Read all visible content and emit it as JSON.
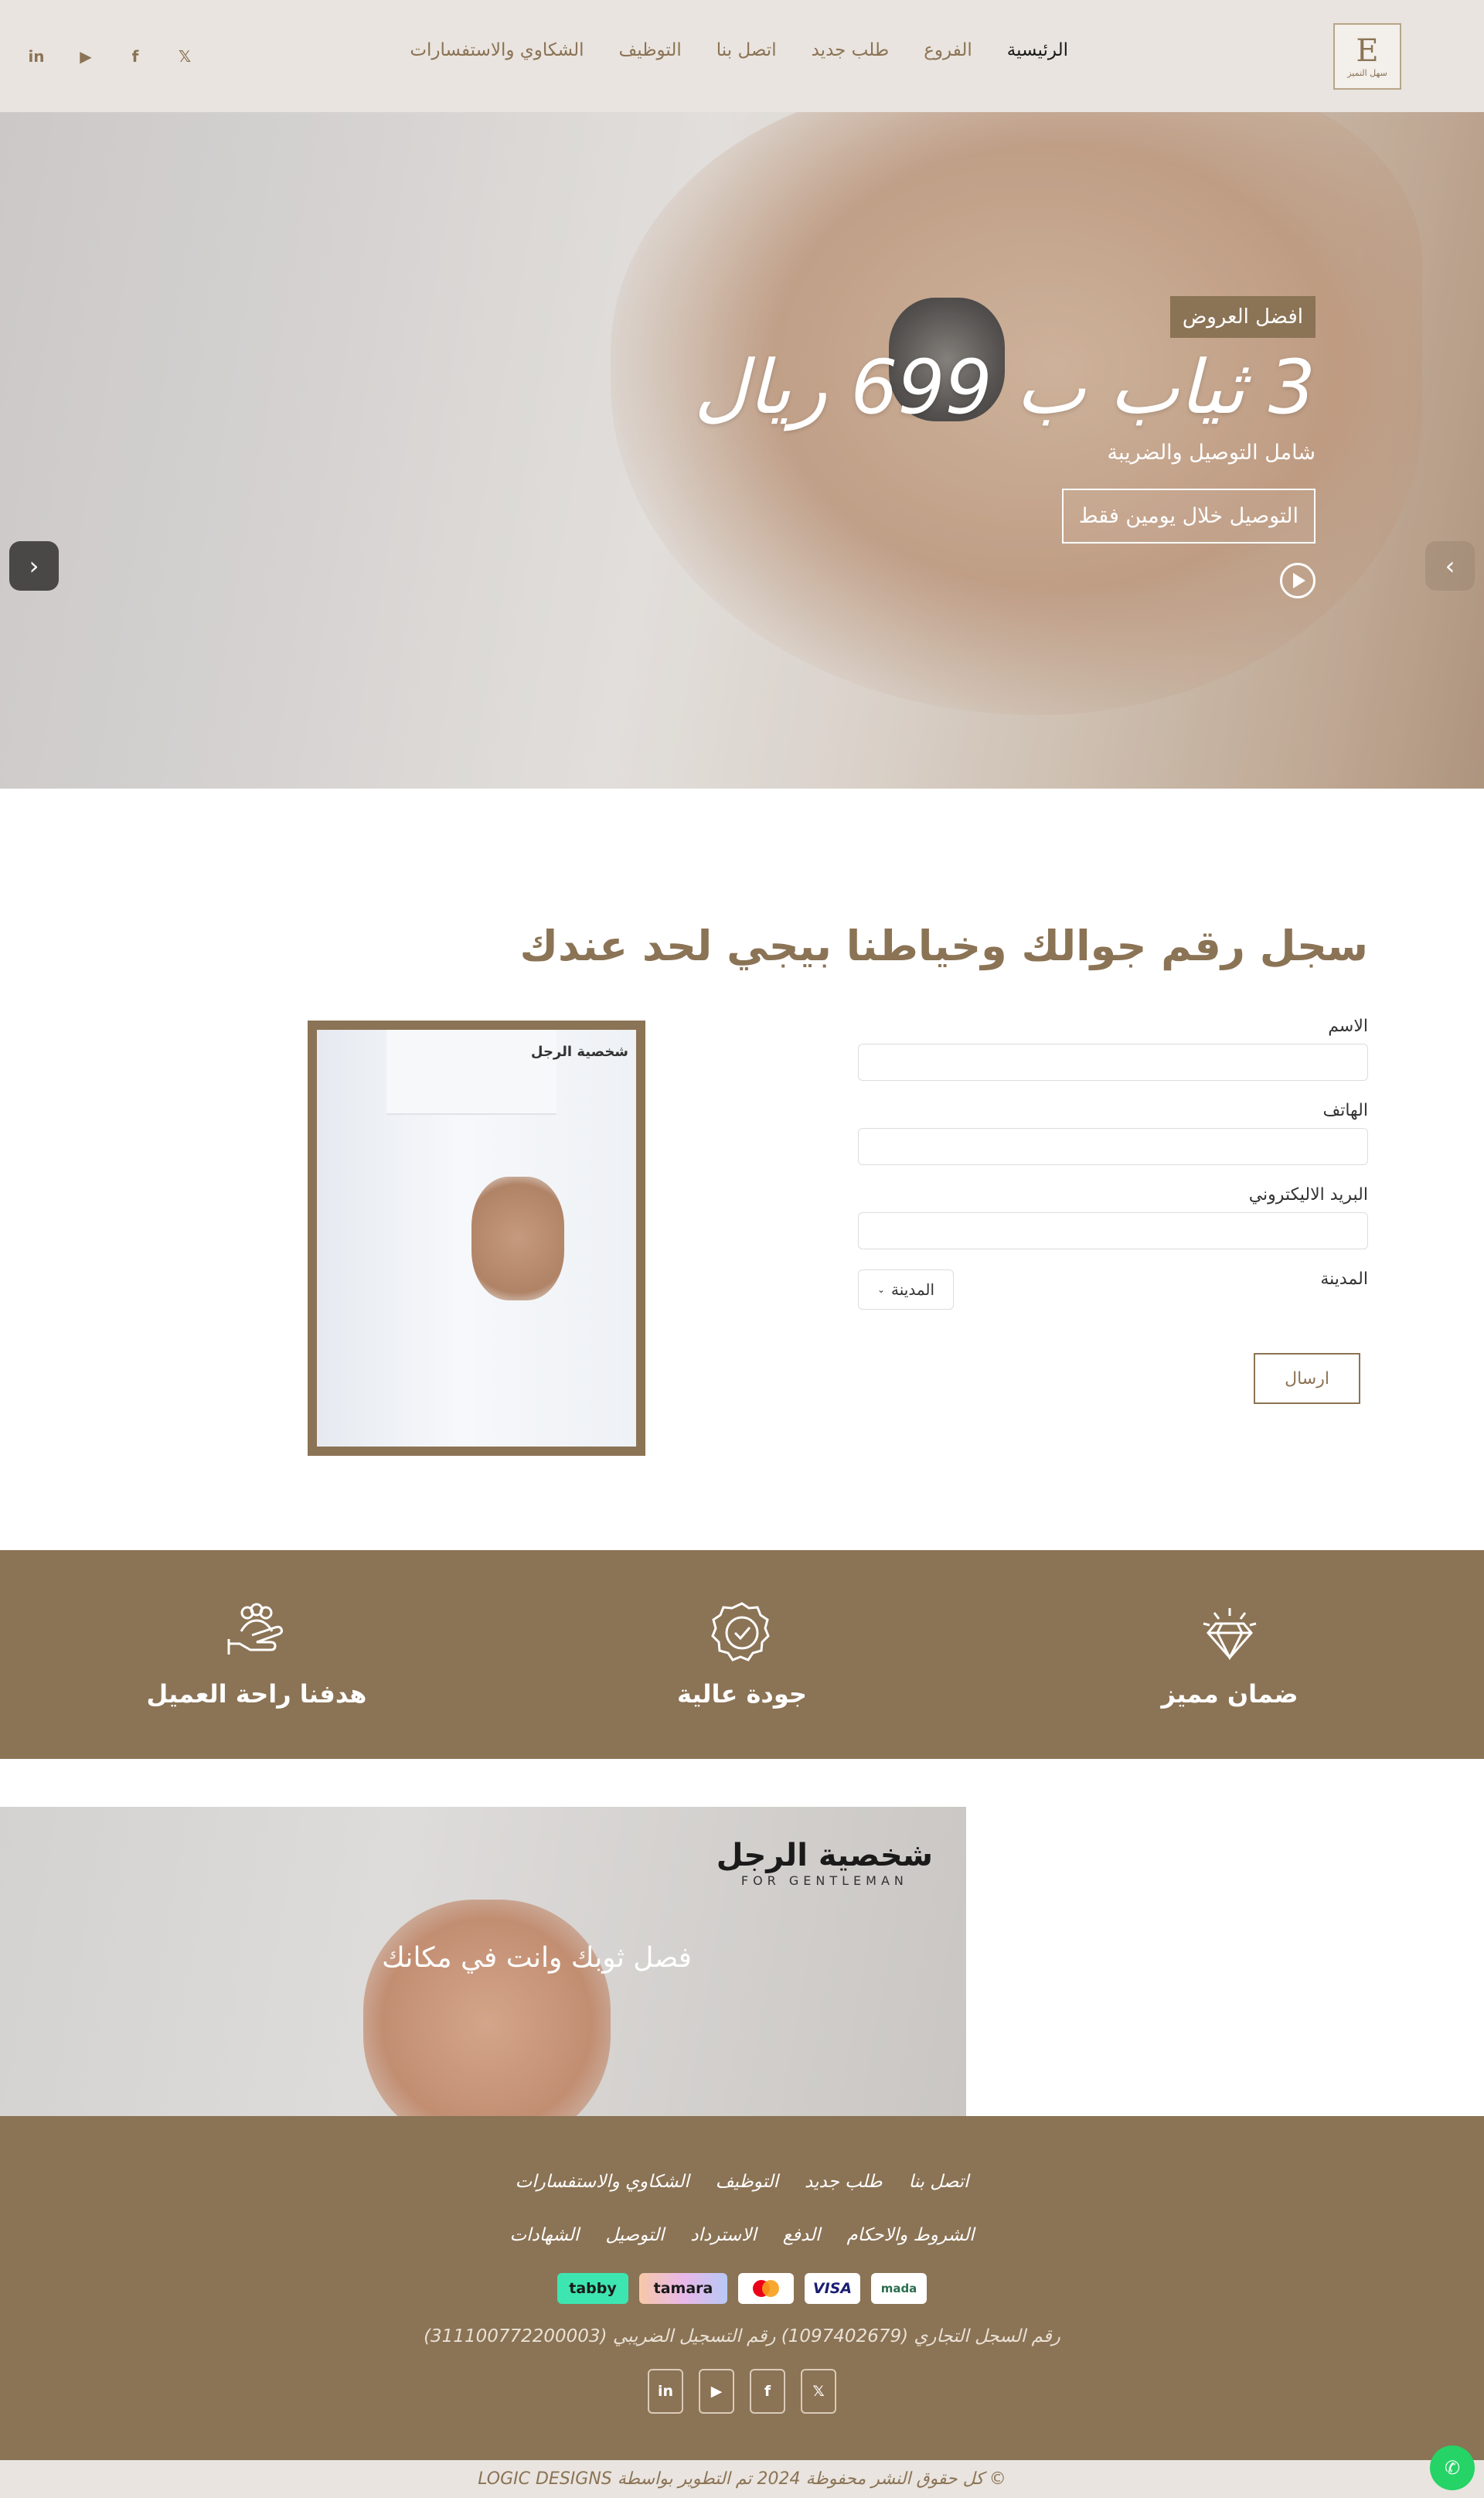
{
  "header": {
    "logo_text": "سهل التميز",
    "nav": [
      {
        "label": "الرئيسية"
      },
      {
        "label": "الفروع"
      },
      {
        "label": "طلب جديد"
      },
      {
        "label": "اتصل بنا"
      },
      {
        "label": "التوظيف"
      },
      {
        "label": "الشكاوي والاستفسارات"
      }
    ],
    "social": [
      {
        "icon": "x-icon",
        "glyph": "𝕏"
      },
      {
        "icon": "facebook-icon",
        "glyph": "f"
      },
      {
        "icon": "youtube-icon",
        "glyph": "▶"
      },
      {
        "icon": "linkedin-icon",
        "glyph": "in"
      }
    ]
  },
  "hero": {
    "badge": "افضل العروض",
    "title": "3 ثياب ب 699 ريال",
    "subtitle": "شامل التوصيل والضريبة",
    "button": "التوصيل خلال يومين فقط"
  },
  "form": {
    "title": "سجل رقم جوالك وخياطنا بيجي لحد عندك",
    "name_label": "الاسم",
    "phone_label": "الهاتف",
    "email_label": "البريد الاليكتروني",
    "city_label": "المدينة",
    "city_selected": "المدينة",
    "submit": "ارسال",
    "image_brand": "شخصية الرجل"
  },
  "features": [
    {
      "icon": "diamond-icon",
      "label": "ضمان مميز"
    },
    {
      "icon": "quality-badge-icon",
      "label": "جودة عالية"
    },
    {
      "icon": "hand-people-icon",
      "label": "هدفنا راحة العميل"
    }
  ],
  "banner": {
    "brand": "شخصية الرجل",
    "brand_sub": "FOR GENTLEMAN",
    "tagline": "فصل ثوبك وانت في مكانك"
  },
  "footer": {
    "links_row1": [
      "اتصل بنا",
      "طلب جديد",
      "التوظيف",
      "الشكاوي والاستفسارات"
    ],
    "links_row2": [
      "الشروط والاحكام",
      "الدفع",
      "الاسترداد",
      "التوصيل",
      "الشهادات"
    ],
    "payments": [
      "mada",
      "VISA",
      "mastercard",
      "tamara",
      "tabby"
    ],
    "registration": "رقم السجل التجاري (1097402679) رقم التسجيل الضريبي (311100772200003)",
    "copyright": "© كل حقوق النشر محفوظة 2024 تم التطوير بواسطة LOGIC DESIGNS"
  },
  "colors": {
    "brand": "#8b7355",
    "header_bg": "#e9e4df",
    "whatsapp": "#25d366"
  }
}
